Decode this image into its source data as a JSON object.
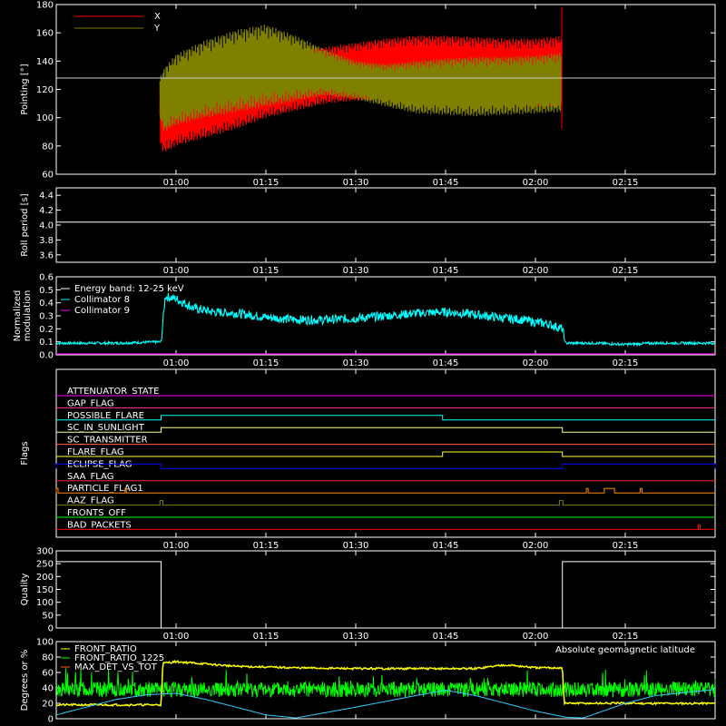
{
  "chart_data": [
    {
      "type": "line",
      "id": "pointing",
      "ylabel": "Pointing [°]",
      "ylim": [
        60,
        180
      ],
      "yticks": [
        60,
        80,
        100,
        120,
        140,
        160,
        180
      ],
      "xticks": [
        "01:00",
        "01:15",
        "01:30",
        "01:45",
        "02:00",
        "02:15"
      ],
      "xrange_minutes": [
        40,
        150
      ],
      "xtick_minutes": [
        60,
        75,
        90,
        105,
        120,
        135
      ],
      "legend": [
        {
          "name": "X",
          "color": "#ff0000"
        },
        {
          "name": "Y",
          "color": "#808000"
        }
      ],
      "reference_line": 128,
      "data_span_minutes": [
        57.3,
        124.4
      ],
      "series": [
        {
          "name": "X",
          "color": "#ff0000",
          "minutes": [
            57.3,
            58,
            60,
            65,
            70,
            75,
            80,
            85,
            90,
            95,
            100,
            105,
            110,
            115,
            120,
            124.4
          ],
          "upper": [
            124,
            128,
            130,
            134,
            140,
            144,
            147,
            150,
            153,
            156,
            158,
            158,
            157,
            156,
            156,
            158
          ],
          "lower": [
            80,
            75,
            80,
            86,
            92,
            100,
            105,
            110,
            112,
            113,
            111,
            110,
            110,
            109,
            108,
            108
          ]
        },
        {
          "name": "Y",
          "color": "#808000",
          "minutes": [
            57.3,
            58,
            60,
            65,
            70,
            75,
            80,
            85,
            90,
            95,
            100,
            105,
            110,
            115,
            120,
            124.4
          ],
          "upper": [
            128,
            135,
            145,
            155,
            162,
            166,
            158,
            148,
            140,
            138,
            140,
            142,
            143,
            143,
            144,
            146
          ],
          "lower": [
            100,
            90,
            95,
            100,
            104,
            108,
            112,
            116,
            113,
            108,
            103,
            102,
            101,
            102,
            103,
            104
          ]
        }
      ]
    },
    {
      "type": "line",
      "id": "roll",
      "ylabel": "Roll period [s]",
      "ylim": [
        3.5,
        4.5
      ],
      "yticks": [
        3.6,
        3.8,
        4.0,
        4.2,
        4.4
      ],
      "xticks": [
        "01:00",
        "01:15",
        "01:30",
        "01:45",
        "02:00",
        "02:15"
      ],
      "series": [
        {
          "name": "roll period",
          "color": "#ffffff",
          "value": 4.04
        }
      ]
    },
    {
      "type": "line",
      "id": "modulation",
      "ylabel": "Normalized modulation",
      "ylabel_lines": [
        "Normalized",
        "modulation"
      ],
      "ylim": [
        0,
        0.6
      ],
      "yticks": [
        0.0,
        0.1,
        0.2,
        0.3,
        0.4,
        0.5,
        0.6
      ],
      "xticks": [
        "01:00",
        "01:15",
        "01:30",
        "01:45",
        "02:00",
        "02:15"
      ],
      "legend": [
        {
          "name": "Energy band: 12-25 keV",
          "color": "#ffffff"
        },
        {
          "name": "Collimator 8",
          "color": "#00ffff"
        },
        {
          "name": "Collimator 9",
          "color": "#ff00ff"
        }
      ],
      "series": [
        {
          "name": "Collimator 8",
          "color": "#00ffff",
          "minutes": [
            40,
            50,
            57.5,
            58.2,
            60,
            63,
            66,
            70,
            75,
            80,
            85,
            90,
            95,
            100,
            105,
            110,
            115,
            118,
            120,
            122,
            124.5,
            125,
            130,
            135,
            140,
            150
          ],
          "values": [
            0.09,
            0.09,
            0.1,
            0.45,
            0.43,
            0.36,
            0.33,
            0.32,
            0.29,
            0.27,
            0.27,
            0.28,
            0.3,
            0.32,
            0.33,
            0.31,
            0.28,
            0.27,
            0.25,
            0.24,
            0.2,
            0.09,
            0.09,
            0.08,
            0.09,
            0.09
          ]
        },
        {
          "name": "Collimator 9",
          "color": "#ff00ff",
          "minutes": [
            40,
            150
          ],
          "values": [
            0.0,
            0.0
          ]
        }
      ]
    },
    {
      "type": "step",
      "id": "flags",
      "ylabel": "Flags",
      "xticks": [
        "01:00",
        "01:15",
        "01:30",
        "01:45",
        "02:00",
        "02:15"
      ],
      "flags": [
        {
          "name": "ATTENUATOR_STATE",
          "color": "#ff00ff",
          "on": []
        },
        {
          "name": "GAP_FLAG",
          "color": "#ff3399",
          "on": []
        },
        {
          "name": "POSSIBLE_FLARE",
          "color": "#00ffff",
          "on": [
            [
              57.5,
              104.5
            ]
          ]
        },
        {
          "name": "SC_IN_SUNLIGHT",
          "color": "#ffff99",
          "on": [
            [
              57.5,
              124.5
            ]
          ]
        },
        {
          "name": "SC_TRANSMITTER",
          "color": "#ff6633",
          "on": []
        },
        {
          "name": "FLARE_FLAG",
          "color": "#ffff33",
          "on": [
            [
              104.5,
              124.5
            ]
          ]
        },
        {
          "name": "ECLIPSE_FLAG",
          "color": "#0000ff",
          "on": [
            [
              40,
              57.5
            ],
            [
              124.5,
              150
            ]
          ]
        },
        {
          "name": "SAA_FLAG",
          "color": "#ff2222",
          "on": []
        },
        {
          "name": "PARTICLE_FLAG1",
          "color": "#ff8800",
          "on": [
            [
              40,
              40.3
            ],
            [
              51.5,
              51.7
            ],
            [
              128.5,
              128.8
            ],
            [
              131.5,
              133.2
            ],
            [
              137.5,
              137.8
            ]
          ]
        },
        {
          "name": "AAZ_FLAG",
          "color": "#808000",
          "on": [
            [
              57.3,
              57.8
            ],
            [
              124.0,
              124.6
            ]
          ]
        },
        {
          "name": "FRONTS_OFF",
          "color": "#00ff00",
          "on": []
        },
        {
          "name": "BAD_PACKETS",
          "color": "#ff0000",
          "on": [
            [
              147.2,
              147.5
            ]
          ]
        }
      ]
    },
    {
      "type": "line",
      "id": "quality",
      "ylabel": "Quality",
      "ylim": [
        0,
        300
      ],
      "yticks": [
        0,
        50,
        100,
        150,
        200,
        250,
        300
      ],
      "xticks": [
        "01:00",
        "01:15",
        "01:30",
        "01:45",
        "02:00",
        "02:15"
      ],
      "series": [
        {
          "name": "quality",
          "color": "#ffffff",
          "minutes": [
            40,
            57.5,
            57.5,
            124.5,
            124.5,
            150
          ],
          "values": [
            258,
            258,
            0,
            0,
            258,
            258
          ]
        }
      ]
    },
    {
      "type": "line",
      "id": "ratios",
      "ylabel": "Degrees or %",
      "ylim": [
        0,
        100
      ],
      "yticks": [
        0,
        20,
        40,
        60,
        80,
        100
      ],
      "legend": [
        {
          "name": "FRONT_RATIO",
          "color": "#ffff00"
        },
        {
          "name": "FRONT_RATIO_1225",
          "color": "#00ff00"
        },
        {
          "name": "MAX_DET_VS_TOT",
          "color": "#ff6600"
        }
      ],
      "annotation": {
        "text": "Absolute geomagnetic latitude",
        "color": "#33ccff"
      },
      "series": [
        {
          "name": "FRONT_RATIO",
          "color": "#ffff00",
          "minutes": [
            40,
            57.5,
            57.8,
            60,
            70,
            80,
            90,
            100,
            110,
            115,
            120,
            124.5,
            124.8,
            150
          ],
          "values": [
            18,
            18,
            72,
            74,
            68,
            66,
            65,
            65,
            65,
            70,
            66,
            66,
            20,
            20
          ]
        },
        {
          "name": "FRONT_RATIO_1225",
          "color": "#00ff00",
          "mean": 38,
          "noise": 10
        },
        {
          "name": "Absolute geomagnetic latitude",
          "color": "#33ccff",
          "minutes": [
            40,
            45,
            50,
            55,
            60,
            65,
            70,
            75,
            80,
            90,
            100,
            105,
            110,
            115,
            120,
            125,
            128,
            135,
            140,
            150
          ],
          "values": [
            5,
            15,
            25,
            31,
            33,
            25,
            15,
            5,
            1,
            15,
            30,
            37,
            30,
            20,
            10,
            2,
            1,
            20,
            30,
            38
          ]
        }
      ]
    }
  ]
}
